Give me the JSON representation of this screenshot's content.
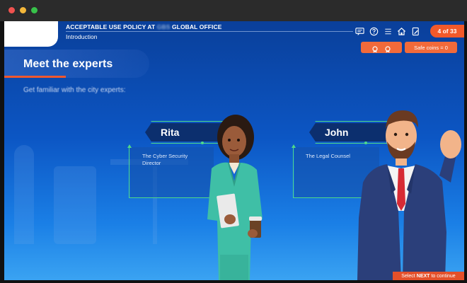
{
  "header": {
    "title_prefix": "ACCEPTABLE USE POLICY AT",
    "title_redacted": "GBS",
    "title_suffix": "GLOBAL OFFICE",
    "section": "Introduction",
    "page_indicator": "4 of 33",
    "icons": [
      "transcript-icon",
      "help-icon",
      "menu-icon",
      "home-icon",
      "notes-icon"
    ]
  },
  "status": {
    "safe_coins": "Safe coins = 0",
    "badge_icons": [
      "badge-icon",
      "badge-icon"
    ]
  },
  "slide": {
    "title": "Meet the experts",
    "subtitle": "Get familiar with the city experts:",
    "experts": [
      {
        "name": "Rita",
        "role_line1": "The Cyber Security",
        "role_line2": "Director"
      },
      {
        "name": "John",
        "role_line1": "The Legal Counsel",
        "role_line2": ""
      }
    ]
  },
  "footer": {
    "prefix": "Select",
    "emphasis": "NEXT",
    "suffix": "to continue"
  },
  "colors": {
    "accent": "#f2592a",
    "highlight_green": "#4fd88a",
    "name_tag": "#0c2f6e"
  }
}
